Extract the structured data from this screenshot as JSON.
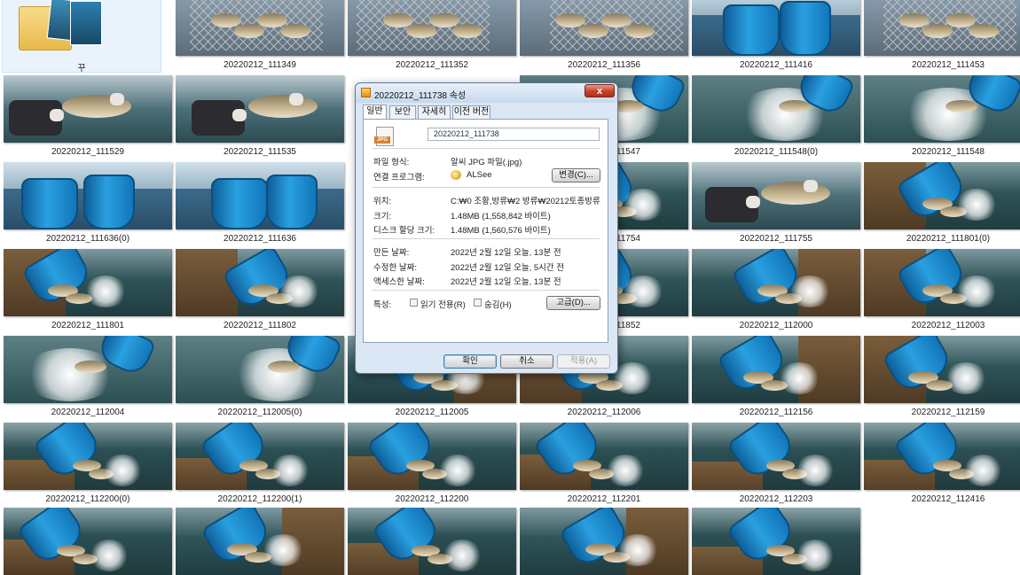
{
  "folder": {
    "label": "꾸"
  },
  "files": [
    "20220212_111349",
    "20220212_111352",
    "20220212_111356",
    "20220212_111416",
    "20220212_111453",
    "20220212_111529",
    "20220212_111535",
    "20220212_111547",
    "20220212_111548(0)",
    "20220212_111548",
    "20220212_111636(0)",
    "20220212_111636",
    "20220212_111754",
    "20220212_111755",
    "20220212_111801(0)",
    "20220212_111801",
    "20220212_111802",
    "20220212_111852",
    "20220212_112000",
    "20220212_112003",
    "20220212_112004",
    "20220212_112005(0)",
    "20220212_112005",
    "20220212_112006",
    "20220212_112156",
    "20220212_112159",
    "20220212_112200(0)",
    "20220212_112200(1)",
    "20220212_112200",
    "20220212_112201",
    "20220212_112203",
    "20220212_112416"
  ],
  "dialog": {
    "title": "20220212_111738 속성",
    "close_glyph": "x",
    "tabs": [
      "일반",
      "보안",
      "자세히",
      "이전 버전"
    ],
    "file_icon": "jpg-file-icon",
    "file_icon_text": "JPG",
    "filename": "20220212_111738",
    "rows": {
      "type_label": "파일 형식:",
      "type_value": "알씨 JPG 파일(.jpg)",
      "program_label": "연결 프로그램:",
      "program_value": "ALSee",
      "change_button": "변경(C)...",
      "location_label": "위치:",
      "location_value": "C:₩0 조황,방류₩2 방류₩20212토종방류",
      "size_label": "크기:",
      "size_value": "1.48MB (1,558,842 바이트)",
      "disk_label": "디스크 할당 크기:",
      "disk_value": "1.48MB (1,560,576 바이트)",
      "created_label": "만든 날짜:",
      "created_value": "2022년 2월 12일 오늘, 13분 전",
      "modified_label": "수정한 날짜:",
      "modified_value": "2022년 2월 12일 오늘, 5시간 전",
      "accessed_label": "액세스한 날짜:",
      "accessed_value": "2022년 2월 12일 오늘, 13분 전",
      "attr_label": "특성:",
      "readonly_label": "읽기 전용(R)",
      "hidden_label": "숨김(H)",
      "advanced_button": "고급(D)..."
    },
    "buttons": {
      "ok": "확인",
      "cancel": "취소",
      "apply": "적용(A)"
    }
  },
  "colors": {
    "accent": "#2aa0e0",
    "close": "#c7402a",
    "water": "#2f5a5e"
  }
}
